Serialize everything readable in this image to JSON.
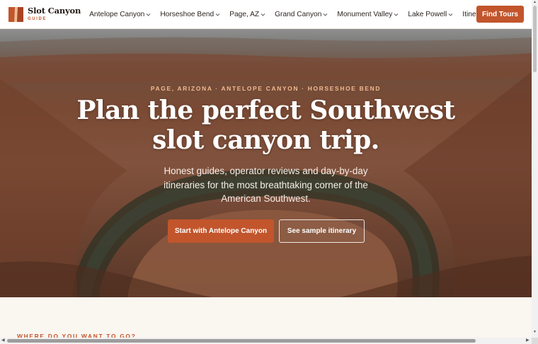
{
  "brand": {
    "name": "Slot Canyon",
    "tagline": "GUIDE",
    "accent": "#c2552c"
  },
  "nav": {
    "items": [
      {
        "label": "Antelope Canyon",
        "dropdown": true
      },
      {
        "label": "Horseshoe Bend",
        "dropdown": true
      },
      {
        "label": "Page, AZ",
        "dropdown": true
      },
      {
        "label": "Grand Canyon",
        "dropdown": true
      },
      {
        "label": "Monument Valley",
        "dropdown": true
      },
      {
        "label": "Lake Powell",
        "dropdown": true
      },
      {
        "label": "Itineraries",
        "dropdown": false
      }
    ],
    "cta_label": "Find Tours"
  },
  "hero": {
    "eyebrow": "PAGE, ARIZONA · ANTELOPE CANYON · HORSESHOE BEND",
    "headline_line1": "Plan the perfect Southwest",
    "headline_line2": "slot canyon trip.",
    "subcopy": "Honest guides, operator reviews and day-by-day itineraries for the most breathtaking corner of the American Southwest.",
    "primary_button": "Start with Antelope Canyon",
    "secondary_button": "See sample itinerary",
    "background": "horseshoe-bend-photo"
  },
  "section": {
    "label": "WHERE DO YOU WANT TO GO?"
  }
}
